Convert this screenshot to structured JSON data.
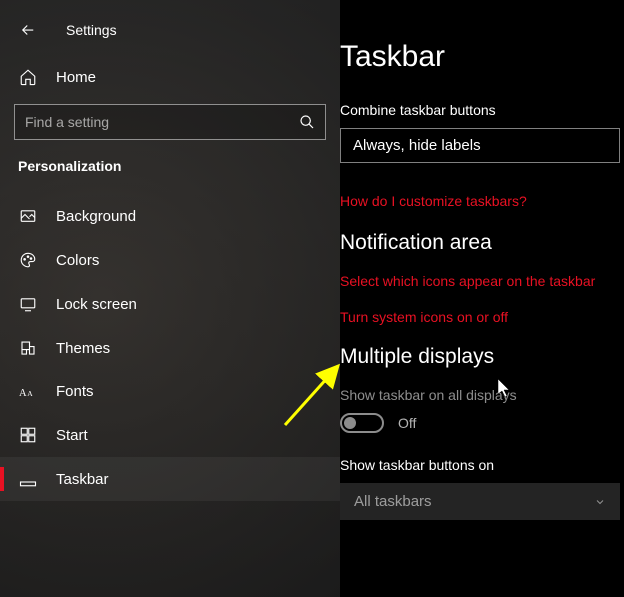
{
  "app_title": "Settings",
  "search": {
    "placeholder": "Find a setting"
  },
  "home_label": "Home",
  "category": "Personalization",
  "nav": {
    "items": [
      {
        "label": "Background"
      },
      {
        "label": "Colors"
      },
      {
        "label": "Lock screen"
      },
      {
        "label": "Themes"
      },
      {
        "label": "Fonts"
      },
      {
        "label": "Start"
      },
      {
        "label": "Taskbar"
      }
    ]
  },
  "page": {
    "title": "Taskbar",
    "combine_label": "Combine taskbar buttons",
    "combine_value": "Always, hide labels",
    "customize_link": "How do I customize taskbars?",
    "notification_header": "Notification area",
    "select_icons_link": "Select which icons appear on the taskbar",
    "system_icons_link": "Turn system icons on or off",
    "multiple_displays_header": "Multiple displays",
    "show_all_displays_label": "Show taskbar on all displays",
    "toggle_state": "Off",
    "show_buttons_on_label": "Show taskbar buttons on",
    "show_buttons_on_value": "All taskbars"
  }
}
